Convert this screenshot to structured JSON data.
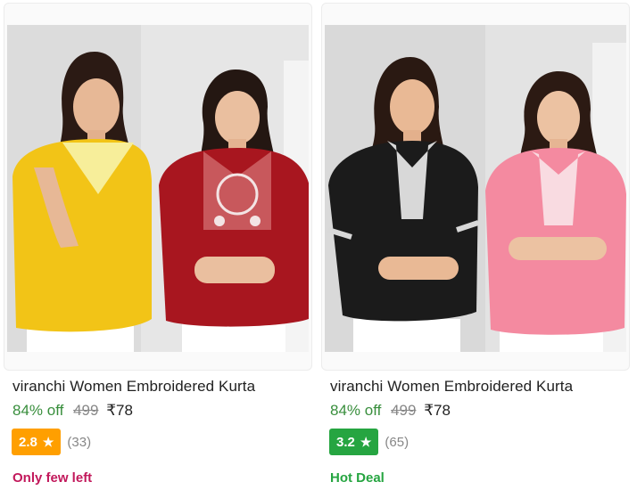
{
  "products": [
    {
      "title": "viranchi Women Embroidered Kurta",
      "discount": "84% off",
      "mrp": "499",
      "price": "₹78",
      "rating": "2.8",
      "rating_color": "#ff9f00",
      "rating_count": "(33)",
      "tag": "Only few left",
      "tag_color": "#c2185b",
      "kurta_colors": [
        "#f2c417",
        "#a8161f"
      ]
    },
    {
      "title": "viranchi Women Embroidered Kurta",
      "discount": "84% off",
      "mrp": "499",
      "price": "₹78",
      "rating": "3.2",
      "rating_color": "#26a541",
      "rating_count": "(65)",
      "tag": "Hot Deal",
      "tag_color": "#26a541",
      "kurta_colors": [
        "#1b1b1b",
        "#f48aa0"
      ]
    }
  ],
  "icons": {
    "star": "star-icon"
  }
}
